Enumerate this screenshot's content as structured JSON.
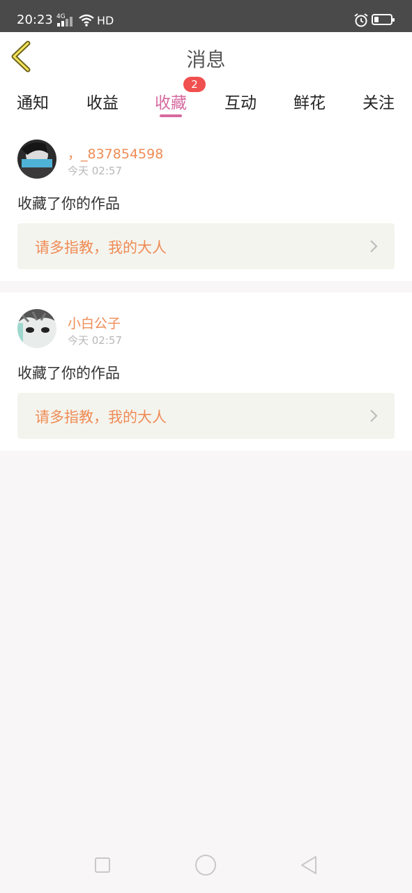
{
  "status_bar": {
    "time": "20:23",
    "network": "4G",
    "hd": "HD"
  },
  "header": {
    "title": "消息"
  },
  "tabs": [
    {
      "label": "通知"
    },
    {
      "label": "收益"
    },
    {
      "label": "收藏",
      "badge": "2",
      "active": true
    },
    {
      "label": "互动"
    },
    {
      "label": "鲜花"
    },
    {
      "label": "关注"
    }
  ],
  "messages": [
    {
      "username": "，_837854598",
      "time": "今天 02:57",
      "action": "收藏了你的作品",
      "reply": "请多指教，我的大人"
    },
    {
      "username": "小白公子",
      "time": "今天 02:57",
      "action": "收藏了你的作品",
      "reply": "请多指教，我的大人"
    }
  ],
  "colors": {
    "accent": "#d76aa0",
    "username": "#ef8b55",
    "badge": "#f0504f",
    "reply_bg": "#f4f4ee"
  }
}
